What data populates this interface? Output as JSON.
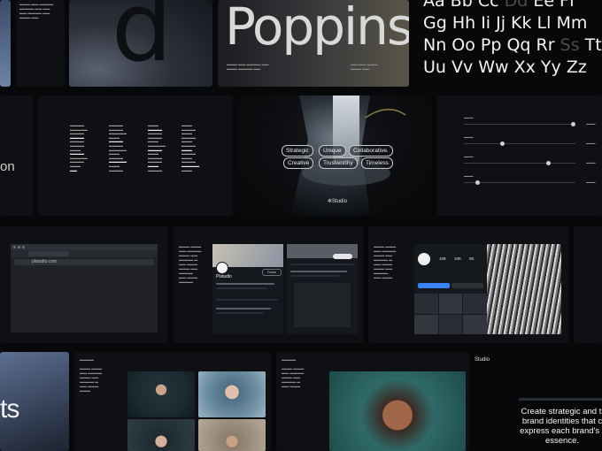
{
  "row1": {
    "letter_d": "d",
    "font_name": "Poppins",
    "alphabet_lines": [
      {
        "parts": [
          {
            "t": "Aa Bb Cc ",
            "dim": false
          },
          {
            "t": "Dd ",
            "dim": true
          },
          {
            "t": "Ee Ff",
            "dim": false
          }
        ]
      },
      {
        "parts": [
          {
            "t": "Gg Hh Ii Jj Kk Ll Mm",
            "dim": false
          }
        ]
      },
      {
        "parts": [
          {
            "t": "Nn Oo Pp Qq Rr ",
            "dim": false
          },
          {
            "t": "Ss",
            "dim": true
          },
          {
            "t": " Tt",
            "dim": false
          }
        ]
      },
      {
        "parts": [
          {
            "t": "Uu Vv Ww Xx Yy Zz",
            "dim": false
          }
        ]
      }
    ]
  },
  "row2": {
    "partial_word": "on",
    "chips": [
      "Strategic",
      "Unique",
      "Collaborative.",
      "Creative",
      "Trustworthy",
      "Timeless"
    ],
    "studio_mark": "Studio",
    "slider_values": [
      0.98,
      0.34,
      0.75,
      0.12
    ]
  },
  "row3": {
    "browser_url": "plstudio.com",
    "profile_name": "Plstudio",
    "follow_label": "Follow",
    "stats": [
      "108",
      "10K",
      "0K"
    ]
  },
  "row4": {
    "partial_word": "ts",
    "statement": "Create strategic and ti brand identities that c express each brand's r essence.",
    "studio_mark": "Studio"
  },
  "colors": {
    "background": "#07080a",
    "card": "#0e1013",
    "accent_blue": "#3b82f6"
  }
}
